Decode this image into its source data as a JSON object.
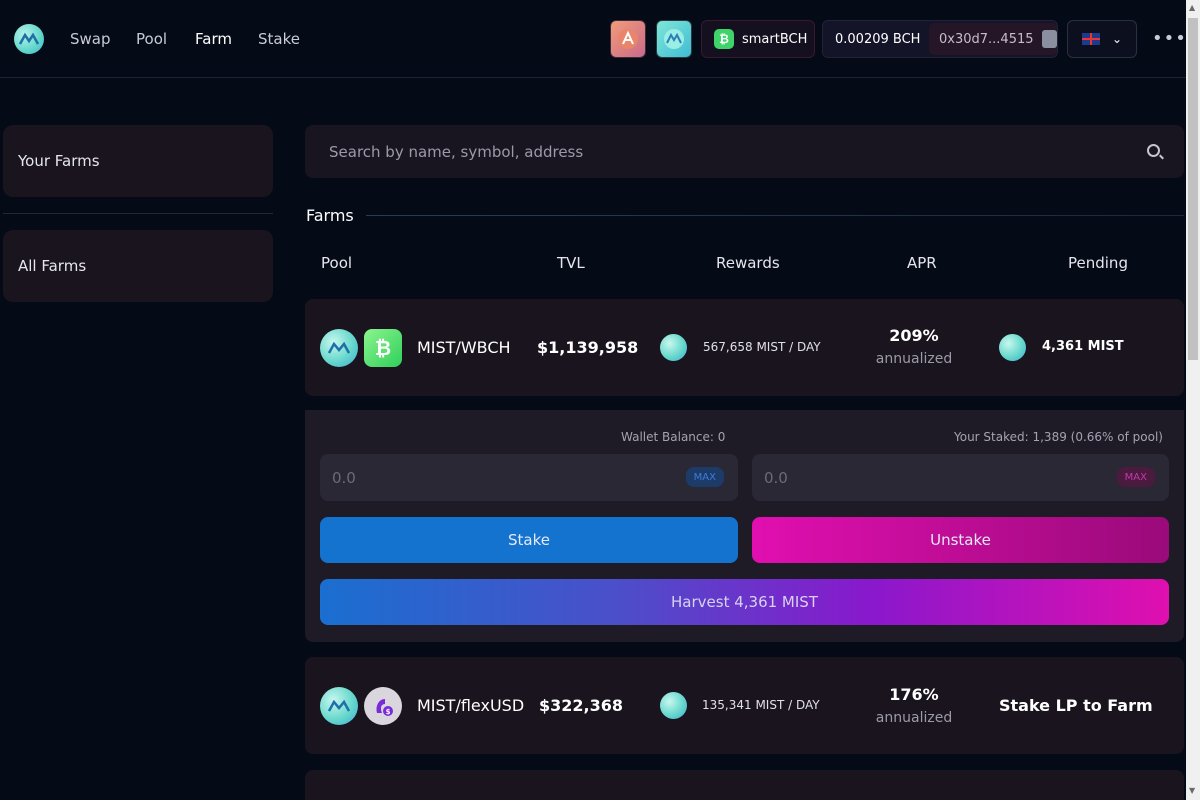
{
  "header": {
    "logo_icon": "mist-logo-icon",
    "nav": [
      "Swap",
      "Pool",
      "Farm",
      "Stake"
    ],
    "active_nav": "Farm",
    "network": "smartBCH",
    "balance": "0.00209 BCH",
    "address": "0x30d7...4515",
    "language_icon": "uk-flag-icon",
    "more_icon": "ellipsis-icon"
  },
  "sidebar": {
    "items": [
      {
        "label": "Your Farms"
      },
      {
        "label": "All Farms"
      }
    ]
  },
  "search": {
    "placeholder": "Search by name, symbol, address"
  },
  "farms": {
    "title": "Farms",
    "columns": [
      "Pool",
      "TVL",
      "Rewards",
      "APR",
      "Pending"
    ],
    "rows": [
      {
        "pair": "MIST/WBCH",
        "tvl": "$1,139,958",
        "rewards": "567,658 MIST / DAY",
        "apr": "209%",
        "apr_sub": "annualized",
        "pending": "4,361 MIST"
      },
      {
        "pair": "MIST/flexUSD",
        "tvl": "$322,368",
        "rewards": "135,341 MIST / DAY",
        "apr": "176%",
        "apr_sub": "annualized",
        "pending": "Stake LP to Farm"
      }
    ],
    "expanded": {
      "wallet_balance": "Wallet Balance: 0",
      "your_staked": "Your Staked: 1,389 (0.66% of pool)",
      "stake_placeholder": "0.0",
      "unstake_placeholder": "0.0",
      "max_label": "MAX",
      "stake_label": "Stake",
      "unstake_label": "Unstake",
      "harvest_label": "Harvest 4,361 MIST"
    }
  },
  "colors": {
    "background": "#050a17",
    "card": "#1a141f",
    "stake_blue": "#1373cf",
    "unstake_pink": "#e10fb0"
  }
}
